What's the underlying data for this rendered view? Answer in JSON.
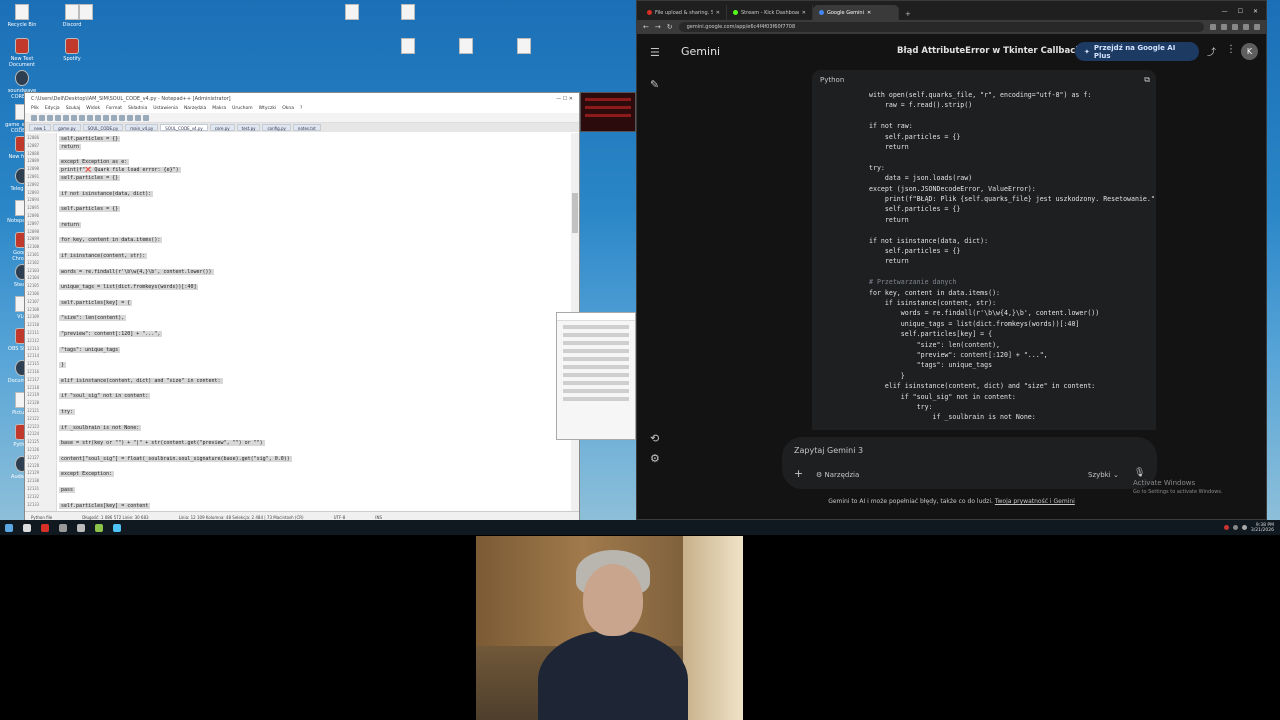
{
  "desktop": {
    "icons": [
      "Recycle Bin",
      "New Text Document",
      "soundwave CORE.py",
      "game_engine CODE.py",
      "New folder",
      "Telegram",
      "Notepad++",
      "Google Chrome",
      "Steam",
      "VLC",
      "OBS Studio",
      "Documents",
      "Pictures",
      "Python",
      "Audacity",
      "Discord",
      "Spotify"
    ]
  },
  "notepadpp": {
    "title": "C:\\Users\\Dell\\Desktop\\IAM_SIM\\SOUL_CODE_v4.py - Notepad++ [Administrator]",
    "menu": [
      "Plik",
      "Edycja",
      "Szukaj",
      "Widok",
      "Format",
      "Składnia",
      "Ustawienia",
      "Narzędzia",
      "Makra",
      "Uruchom",
      "Wtyczki",
      "Okna",
      "?"
    ],
    "tabs": [
      "new 1",
      "game.py",
      "SOUL_CODE.py",
      "main_v4.py",
      "SOUL_CODE_v4.py",
      "core.py",
      "test.py",
      "config.py",
      "notes.txt"
    ],
    "line_numbers": [
      "12086",
      "12087",
      "12088",
      "12089",
      "12090",
      "12091",
      "12092",
      "12093",
      "12094",
      "12095",
      "12096",
      "12097",
      "12098",
      "12099",
      "12100",
      "12101",
      "12102",
      "12103",
      "12104",
      "12105",
      "12106",
      "12107",
      "12108",
      "12109",
      "12110",
      "12111",
      "12112",
      "12113",
      "12114",
      "12115",
      "12116",
      "12117",
      "12118",
      "12119",
      "12120",
      "12121",
      "12122",
      "12123",
      "12124",
      "12125",
      "12126",
      "12127",
      "12128",
      "12129",
      "12130",
      "12131",
      "12132",
      "12133",
      "12134",
      "12135",
      "12136",
      "12137",
      "12138",
      "12139",
      "12140"
    ],
    "code": [
      "                    self.particles = {}",
      "                    return",
      "",
      "            except Exception as e:",
      "                print(f\"❌ Quark file load error: {e}\")",
      "                self.particles = {}",
      "",
      "            if not isinstance(data, dict):",
      "",
      "                self.particles = {}",
      "",
      "                return",
      "",
      "            for key, content in data.items():",
      "",
      "                if isinstance(content, str):",
      "",
      "                    words = re.findall(r'\\b\\w{4,}\\b', content.lower())",
      "",
      "                    unique_tags = list(dict.fromkeys(words))[:40]",
      "",
      "                    self.particles[key] = {",
      "",
      "                        \"size\": len(content),",
      "",
      "                        \"preview\": content[:120] + \"...\",",
      "",
      "                        \"tags\": unique_tags",
      "",
      "                    }",
      "",
      "                elif isinstance(content, dict) and \"size\" in content:",
      "",
      "                    if \"soul_sig\" not in content:",
      "",
      "                        try:",
      "",
      "                            if _soulbrain is not None:",
      "",
      "                                base = str(key or \"\") + \"|\" + str(content.get(\"preview\", \"\") or \"\")",
      "",
      "                                content[\"soul_sig\"] = float(_soulbrain.soul_signature(base).get(\"sig\", 0.0))",
      "",
      "                        except Exception:",
      "",
      "                            pass",
      "",
      "                    self.particles[key] = content"
    ],
    "status": {
      "type": "Python file",
      "length": "Długość: 1 086 572   Linie: 30 683",
      "position": "Linia: 12 109   Kolumna: 48   Selekcja: 2 484 | 73   Macintosh (CR)",
      "encoding": "UTF-8",
      "mode": "INS"
    }
  },
  "chrome": {
    "tabs": [
      {
        "label": "File upload & sharing. Send large fil",
        "color": "#d93025"
      },
      {
        "label": "Stream - Kick Dashboard",
        "color": "#53fc18"
      },
      {
        "label": "Google Gemini",
        "color": "#4285f4"
      }
    ],
    "new_tab": "+",
    "window_controls": [
      "—",
      "☐",
      "✕"
    ],
    "url": "gemini.google.com/app/e6c4f4f03f60f7708"
  },
  "gemini": {
    "brand": "Gemini",
    "chat_title": "Błąd AttributeError w Tkinter Callback",
    "upgrade_label": "Przejdź na Google AI Plus",
    "avatar_letter": "K",
    "code_language": "Python",
    "code_lines": [
      "with open(self.quarks_file, \"r\", encoding=\"utf-8\") as f:",
      "    raw = f.read().strip()",
      "",
      "if not raw:",
      "    self.particles = {}",
      "    return",
      "",
      "try:",
      "    data = json.loads(raw)",
      "except (json.JSONDecodeError, ValueError):",
      "    print(f\"BŁĄD: Plik {self.quarks_file} jest uszkodzony. Resetowanie.\")",
      "    self.particles = {}",
      "    return",
      "",
      "if not isinstance(data, dict):",
      "    self.particles = {}",
      "    return",
      "",
      "# Przetwarzanie danych",
      "for key, content in data.items():",
      "    if isinstance(content, str):",
      "        words = re.findall(r'\\b\\w{4,}\\b', content.lower())",
      "        unique_tags = list(dict.fromkeys(words))[:40]",
      "        self.particles[key] = {",
      "            \"size\": len(content),",
      "            \"preview\": content[:120] + \"...\",",
      "            \"tags\": unique_tags",
      "        }",
      "    elif isinstance(content, dict) and \"size\" in content:",
      "        if \"soul_sig\" not in content:",
      "            try:",
      "                if _soulbrain is not None:"
    ],
    "prompt_placeholder": "Zapytaj Gemini 3",
    "tools_label": "Narzędzia",
    "mode_label": "Szybki",
    "footer_text": "Gemini to AI i może popełniać błędy, także co do ludzi.",
    "footer_link": "Twoja prywatność i Gemini",
    "activate_title": "Activate Windows",
    "activate_sub": "Go to Settings to activate Windows."
  },
  "taskbar": {
    "time": "9:38 PM",
    "date": "3/21/2026"
  },
  "colors": {
    "gemini_bg": "#131314",
    "upgrade_btn": "#1d3a63",
    "desktop_blue": "#1b6fb6"
  }
}
